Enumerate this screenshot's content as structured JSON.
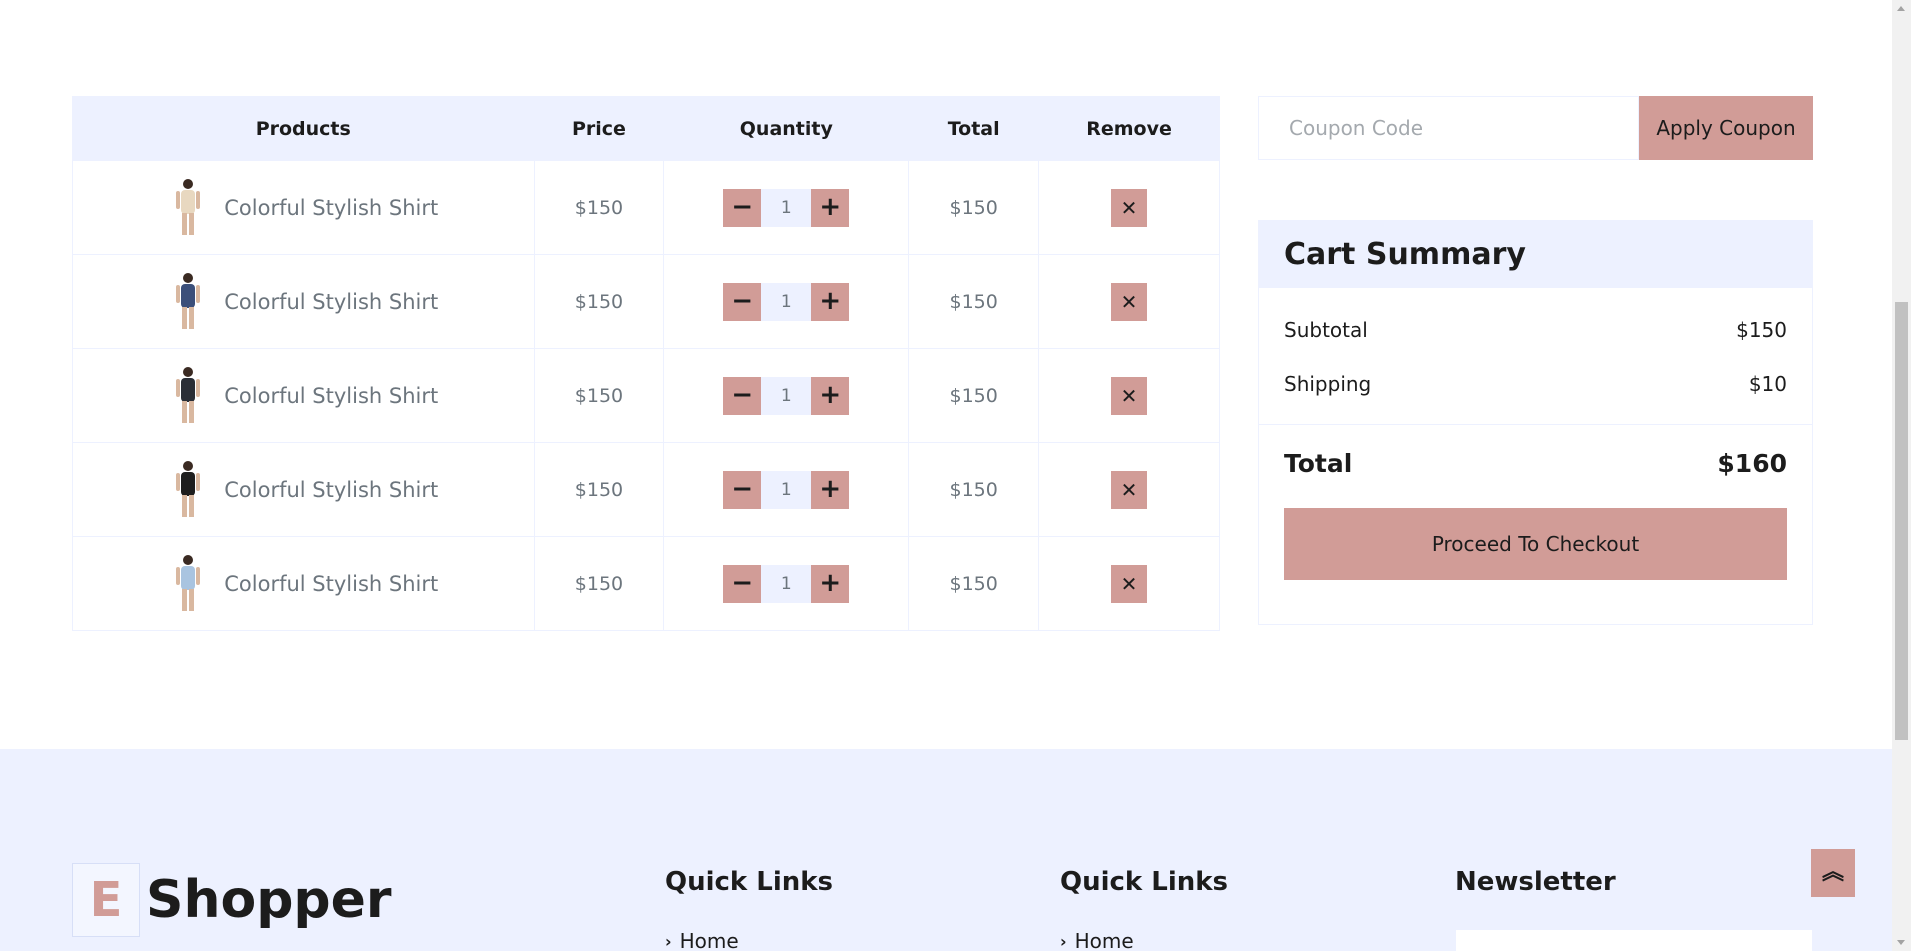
{
  "cart": {
    "headers": {
      "products": "Products",
      "price": "Price",
      "quantity": "Quantity",
      "total": "Total",
      "remove": "Remove"
    },
    "items": [
      {
        "name": "Colorful Stylish Shirt",
        "price": "$150",
        "quantity": "1",
        "total": "$150",
        "image": "woman-white-dress",
        "color": "#e8d8c0"
      },
      {
        "name": "Colorful Stylish Shirt",
        "price": "$150",
        "quantity": "1",
        "total": "$150",
        "image": "man-denim-jacket",
        "color": "#3b4f7a"
      },
      {
        "name": "Colorful Stylish Shirt",
        "price": "$150",
        "quantity": "1",
        "total": "$150",
        "image": "man-black-hoodie",
        "color": "#2a2e36"
      },
      {
        "name": "Colorful Stylish Shirt",
        "price": "$150",
        "quantity": "1",
        "total": "$150",
        "image": "woman-black-dress",
        "color": "#1e1e1e"
      },
      {
        "name": "Colorful Stylish Shirt",
        "price": "$150",
        "quantity": "1",
        "total": "$150",
        "image": "woman-floral-top",
        "color": "#a9c4e0"
      }
    ],
    "minus_symbol": "−",
    "plus_symbol": "+",
    "remove_symbol": "✕"
  },
  "coupon": {
    "placeholder": "Coupon Code",
    "button_label": "Apply Coupon"
  },
  "summary": {
    "title": "Cart Summary",
    "subtotal_label": "Subtotal",
    "subtotal_value": "$150",
    "shipping_label": "Shipping",
    "shipping_value": "$10",
    "total_label": "Total",
    "total_value": "$160",
    "checkout_label": "Proceed To Checkout"
  },
  "footer": {
    "logo_letter": "E",
    "logo_text": "Shopper",
    "quick_links_1_title": "Quick Links",
    "quick_links_1_first": "Home",
    "quick_links_2_title": "Quick Links",
    "quick_links_2_first": "Home",
    "newsletter_title": "Newsletter"
  },
  "back_to_top": "double-chevron-up-icon",
  "colors": {
    "accent": "#d19c97",
    "secondary": "#edf1ff",
    "dark": "#1c1c1c"
  }
}
